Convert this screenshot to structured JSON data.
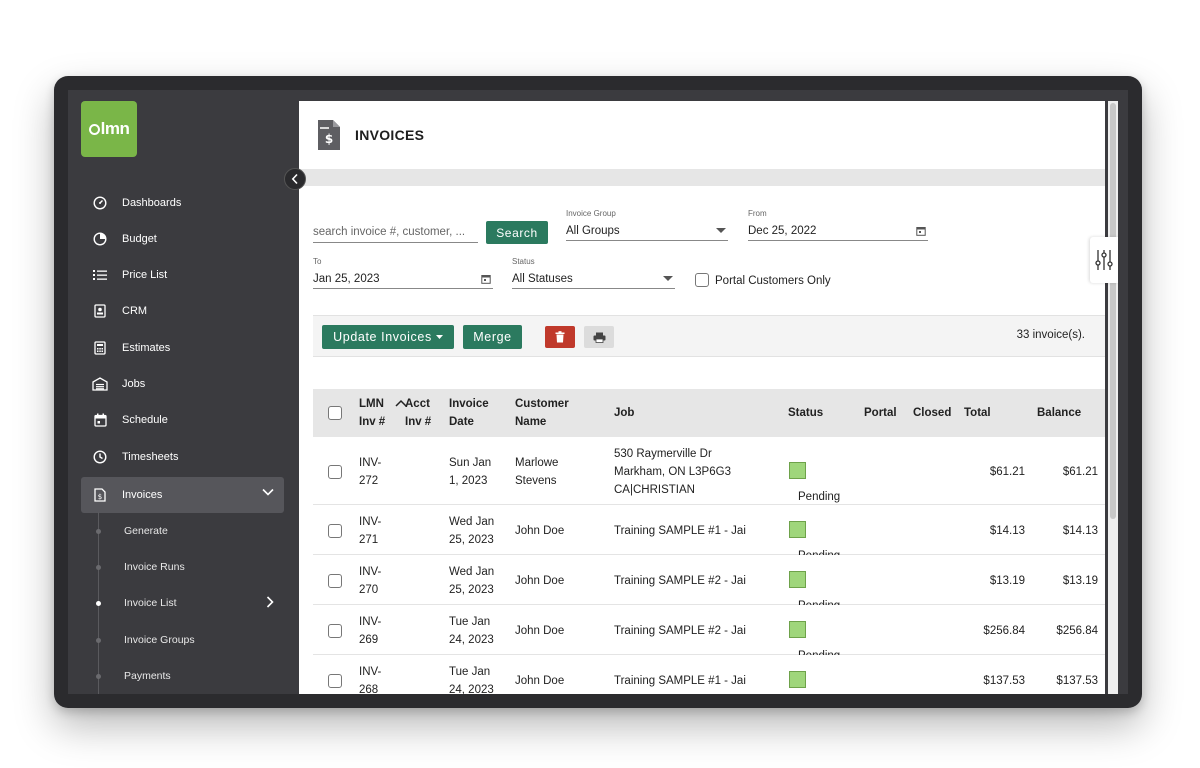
{
  "brand": {
    "logo_text": "lmn",
    "accent": "#7ab648",
    "primary_button": "#2b7a5f",
    "danger": "#c0392b"
  },
  "sidebar": {
    "items": [
      {
        "label": "Dashboards",
        "icon": "gauge-icon"
      },
      {
        "label": "Budget",
        "icon": "pie-chart-icon"
      },
      {
        "label": "Price List",
        "icon": "list-icon"
      },
      {
        "label": "CRM",
        "icon": "contact-card-icon"
      },
      {
        "label": "Estimates",
        "icon": "calculator-icon"
      },
      {
        "label": "Jobs",
        "icon": "garage-icon"
      },
      {
        "label": "Schedule",
        "icon": "calendar-icon"
      },
      {
        "label": "Timesheets",
        "icon": "clock-icon"
      },
      {
        "label": "Invoices",
        "icon": "invoice-icon",
        "active": true
      }
    ],
    "subitems": [
      {
        "label": "Generate"
      },
      {
        "label": "Invoice Runs"
      },
      {
        "label": "Invoice List",
        "active": true
      },
      {
        "label": "Invoice Groups"
      },
      {
        "label": "Payments"
      }
    ]
  },
  "page": {
    "title": "INVOICES"
  },
  "filters": {
    "search_placeholder": "search invoice #, customer, ...",
    "search_button": "Search",
    "invoice_group_label": "Invoice Group",
    "invoice_group_value": "All Groups",
    "from_label": "From",
    "from_value": "Dec 25, 2022",
    "to_label": "To",
    "to_value": "Jan 25, 2023",
    "status_label": "Status",
    "status_value": "All Statuses",
    "portal_only_label": "Portal Customers Only"
  },
  "toolbar": {
    "update_label": "Update Invoices",
    "merge_label": "Merge",
    "count_text": "33 invoice(s)."
  },
  "table": {
    "headers": {
      "lmn_1": "LMN",
      "lmn_2": "Inv #",
      "acct_1": "Acct",
      "acct_2": "Inv #",
      "date_1": "Invoice",
      "date_2": "Date",
      "cust_1": "Customer",
      "cust_2": "Name",
      "job": "Job",
      "status": "Status",
      "portal": "Portal",
      "closed": "Closed",
      "total": "Total",
      "balance": "Balance"
    },
    "rows": [
      {
        "inv_1": "INV-",
        "inv_2": "272",
        "date_1": "Sun Jan",
        "date_2": "1, 2023",
        "cust_1": "Marlowe",
        "cust_2": "Stevens",
        "job_1": "530 Raymerville Dr",
        "job_2": "Markham, ON L3P6G3",
        "job_3": "CA|CHRISTIAN",
        "status": "Pending",
        "total": "$61.21",
        "balance": "$61.21"
      },
      {
        "inv_1": "INV-",
        "inv_2": "271",
        "date_1": "Wed Jan",
        "date_2": "25, 2023",
        "cust_1": "John Doe",
        "cust_2": "",
        "job_1": "Training SAMPLE #1 - Jai",
        "job_2": "",
        "job_3": "",
        "status": "Pending",
        "total": "$14.13",
        "balance": "$14.13"
      },
      {
        "inv_1": "INV-",
        "inv_2": "270",
        "date_1": "Wed Jan",
        "date_2": "25, 2023",
        "cust_1": "John Doe",
        "cust_2": "",
        "job_1": "Training SAMPLE #2 - Jai",
        "job_2": "",
        "job_3": "",
        "status": "Pending",
        "total": "$13.19",
        "balance": "$13.19"
      },
      {
        "inv_1": "INV-",
        "inv_2": "269",
        "date_1": "Tue Jan",
        "date_2": "24, 2023",
        "cust_1": "John Doe",
        "cust_2": "",
        "job_1": "Training SAMPLE #2 - Jai",
        "job_2": "",
        "job_3": "",
        "status": "Pending",
        "total": "$256.84",
        "balance": "$256.84"
      },
      {
        "inv_1": "INV-",
        "inv_2": "268",
        "date_1": "Tue Jan",
        "date_2": "24, 2023",
        "cust_1": "John Doe",
        "cust_2": "",
        "job_1": "Training SAMPLE #1 - Jai",
        "job_2": "",
        "job_3": "",
        "status": "",
        "total": "$137.53",
        "balance": "$137.53"
      }
    ]
  }
}
